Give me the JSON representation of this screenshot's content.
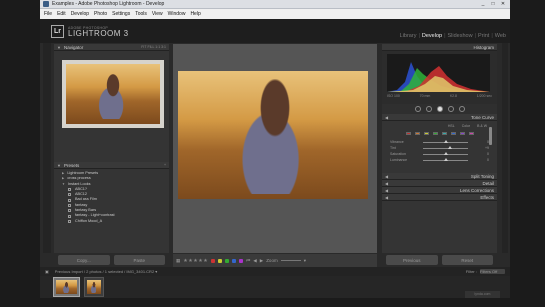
{
  "window": {
    "title": "Examples - Adobe Photoshop Lightroom - Develop",
    "controls": [
      "_",
      "□",
      "✕"
    ]
  },
  "menu": [
    "File",
    "Edit",
    "Develop",
    "Photo",
    "Settings",
    "Tools",
    "View",
    "Window",
    "Help"
  ],
  "brand": {
    "badge": "Lr",
    "small": "ADOBE PHOTOSHOP",
    "big": "LIGHTROOM 3"
  },
  "modules": [
    {
      "label": "Library",
      "active": false
    },
    {
      "label": "Develop",
      "active": true
    },
    {
      "label": "Slideshow",
      "active": false
    },
    {
      "label": "Print",
      "active": false
    },
    {
      "label": "Web",
      "active": false
    }
  ],
  "navigator": {
    "title": "Navigator",
    "options": "FIT  FILL  1:1  3:1"
  },
  "presets": {
    "title": "Presets",
    "items": [
      {
        "label": "Lightroom Presets",
        "type": "folder"
      },
      {
        "label": "cross process",
        "type": "folder"
      },
      {
        "label": "Instant Looks",
        "type": "folder-open"
      },
      {
        "label": "ABC1?",
        "type": "preset"
      },
      {
        "label": "ABC12",
        "type": "preset"
      },
      {
        "label": "Bad ass Film",
        "type": "preset"
      },
      {
        "label": "fantasy",
        "type": "preset"
      },
      {
        "label": "fantasy Bars",
        "type": "preset"
      },
      {
        "label": "fantasy - Light+contrast",
        "type": "preset"
      },
      {
        "label": "Chiffon Mood_A",
        "type": "preset"
      }
    ]
  },
  "left_buttons": {
    "copy": "Copy...",
    "paste": "Paste"
  },
  "histogram": {
    "title": "Histogram",
    "info": [
      "ISO 100",
      "70 mm",
      "f/2.8",
      "1/200 sec"
    ]
  },
  "right_sections": {
    "tone_curve": "Tone Curve",
    "hsl_tabs": [
      "HSL",
      "Color",
      "B & W"
    ],
    "split_toning": "Split Toning",
    "detail": "Detail",
    "lens_corrections": "Lens Corrections",
    "effects": "Effects"
  },
  "sliders": [
    {
      "label": "Vibrance",
      "value": "0",
      "level": 0.5
    },
    {
      "label": "Tint",
      "value": "+9",
      "level": 0.6
    },
    {
      "label": "Saturation",
      "value": "0",
      "level": 0.5
    },
    {
      "label": "Luminance",
      "value": "0",
      "level": 0.5
    }
  ],
  "right_buttons": {
    "previous": "Previous",
    "reset": "Reset"
  },
  "toolbar": {
    "stars": "★★★★★",
    "flags": [
      "#c33",
      "#cc3",
      "#3a3",
      "#36c",
      "#a3c"
    ],
    "zoom_label": "Zoom",
    "nav": [
      "⏮",
      "◀",
      "▶"
    ]
  },
  "filmstrip": {
    "nav_text": "Previous Import / 2 photos / 1 selected / IMG_3401.CR2 ▾",
    "filter_label": "Filter :",
    "filter_value": "Filters Off",
    "thumbs": [
      {
        "selected": true
      },
      {
        "selected": false
      }
    ]
  },
  "watermark": "lynda.com"
}
